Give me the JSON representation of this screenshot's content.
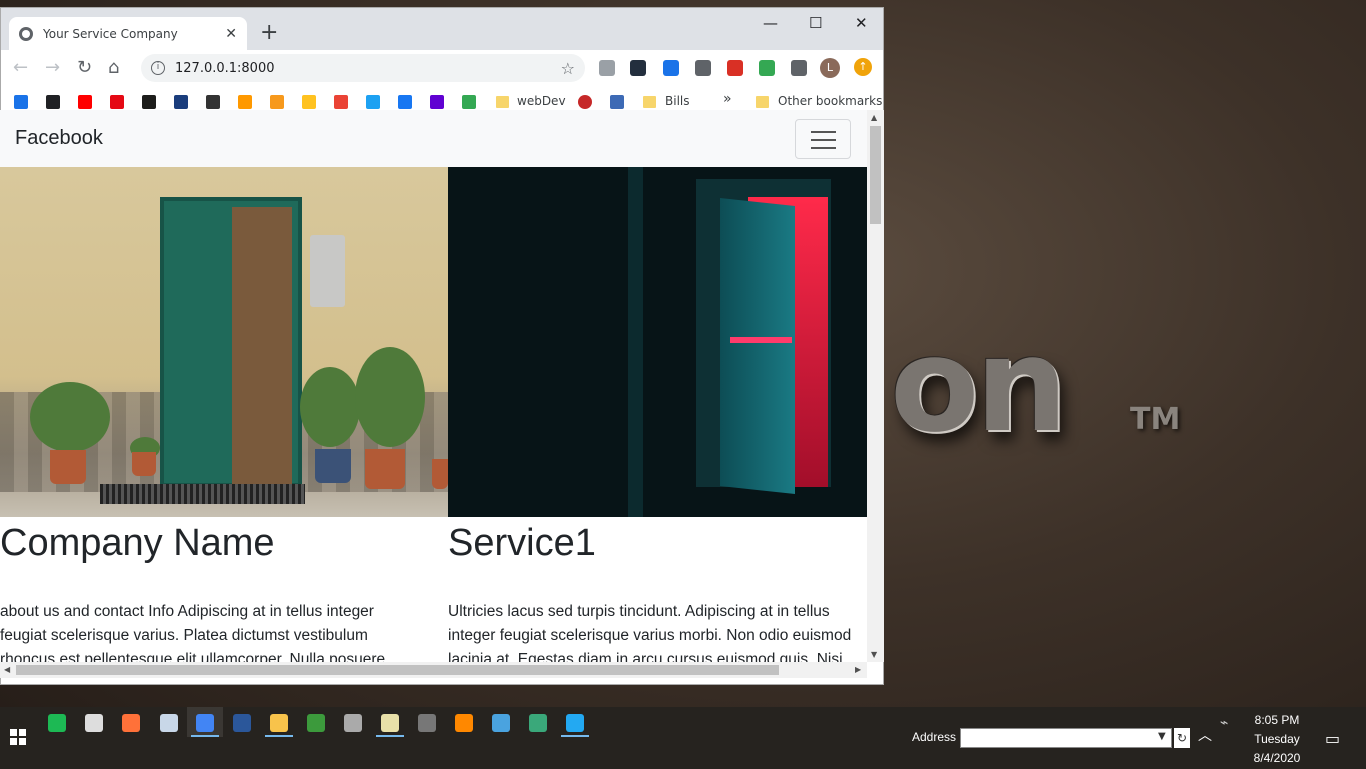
{
  "desktop": {
    "logo_text": "on",
    "logo_tm": "TM"
  },
  "browser": {
    "tab_title": "Your Service Company",
    "tab_close": "✕",
    "new_tab": "+",
    "window_controls": {
      "minimize": "—",
      "maximize": "☐",
      "close": "✕"
    },
    "nav": {
      "back": "←",
      "forward": "→",
      "reload": "↻",
      "home": "⌂"
    },
    "url": "127.0.0.1:8000",
    "info_glyph": "i",
    "star_glyph": "☆",
    "avatar_letter": "L",
    "update_glyph": "↑",
    "extensions": [
      {
        "name": "extension-gray-icon",
        "color": "#9aa0a6"
      },
      {
        "name": "amazon-assistant-icon",
        "color": "#232f3e"
      },
      {
        "name": "checkmark-ext-icon",
        "color": "#1a73e8"
      },
      {
        "name": "bird-ext-icon",
        "color": "#5f6368"
      },
      {
        "name": "new-badge-icon",
        "color": "#d93025"
      },
      {
        "name": "color-wheel-icon",
        "color": "#34a853"
      },
      {
        "name": "puzzle-icon",
        "color": "#5f6368"
      }
    ],
    "bookmarks": {
      "icons": [
        {
          "name": "settings-icon",
          "color": "#1a73e8"
        },
        {
          "name": "circle-icon",
          "color": "#202124"
        },
        {
          "name": "youtube-icon",
          "color": "#ff0000"
        },
        {
          "name": "netflix-icon",
          "color": "#e50914"
        },
        {
          "name": "dw-icon",
          "color": "#1d1d1b"
        },
        {
          "name": "news-icon",
          "color": "#1a3d7c"
        },
        {
          "name": "wikipedia-icon",
          "color": "#333333"
        },
        {
          "name": "amazon-icon",
          "color": "#ff9900"
        },
        {
          "name": "audible-icon",
          "color": "#f7991c"
        },
        {
          "name": "walmart-icon",
          "color": "#ffc220"
        },
        {
          "name": "gmail-icon",
          "color": "#ea4335"
        },
        {
          "name": "twitter-icon",
          "color": "#1da1f2"
        },
        {
          "name": "facebook-icon",
          "color": "#1877f2"
        },
        {
          "name": "yahoo-icon",
          "color": "#6001d2"
        },
        {
          "name": "drive-icon",
          "color": "#34a853"
        }
      ],
      "folder_webdev": "webDev",
      "folder_bills": "Bills",
      "overflow": "»",
      "other": "Other bookmarks"
    }
  },
  "page": {
    "brand": "Facebook",
    "columns": [
      {
        "heading": "Company Name",
        "body": "about us and contact Info Adipiscing at in tellus integer feugiat scelerisque varius. Platea dictumst vestibulum rhoncus est pellentesque elit ullamcorper. Nulla posuere"
      },
      {
        "heading": "Service1",
        "body": "Ultricies lacus sed turpis tincidunt. Adipiscing at in tellus integer feugiat scelerisque varius morbi. Non odio euismod lacinia at. Egestas diam in arcu cursus euismod quis. Nisi"
      }
    ]
  },
  "taskbar": {
    "apps": [
      {
        "name": "spotify-icon",
        "color": "#1db954"
      },
      {
        "name": "store-icon",
        "color": "#dddddd"
      },
      {
        "name": "firefox-icon",
        "color": "#ff7139"
      },
      {
        "name": "notes-icon",
        "color": "#c8d7e8"
      },
      {
        "name": "chrome-icon",
        "color": "#4285f4"
      },
      {
        "name": "word-icon",
        "color": "#2b579a"
      },
      {
        "name": "file-explorer-icon",
        "color": "#f8c34b"
      },
      {
        "name": "h-app-icon",
        "color": "#3c9a3c"
      },
      {
        "name": "gimp-icon",
        "color": "#aaaaaa"
      },
      {
        "name": "notepad-icon",
        "color": "#e8e0a8"
      },
      {
        "name": "terminal-icon",
        "color": "#777777"
      },
      {
        "name": "vlc-icon",
        "color": "#ff8800"
      },
      {
        "name": "reader-icon",
        "color": "#4aa3df"
      },
      {
        "name": "globe-app-icon",
        "color": "#3aa87a"
      },
      {
        "name": "vscode-icon",
        "color": "#23a9f2"
      }
    ],
    "address_label": "Address",
    "address_value": "",
    "time": "8:05 PM",
    "day": "Tuesday",
    "date": "8/4/2020"
  }
}
